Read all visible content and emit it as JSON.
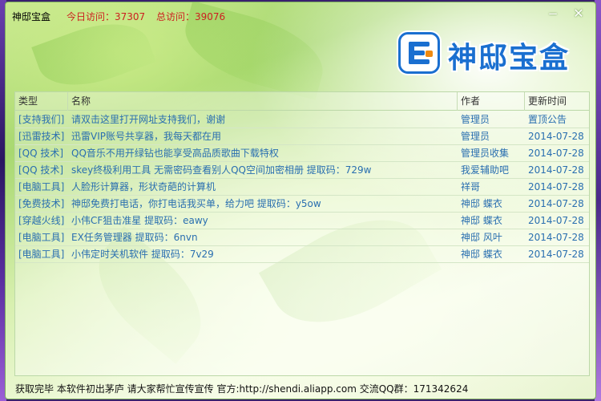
{
  "titlebar": {
    "app_title": "神邸宝盒",
    "today_visits": "今日访问：37307",
    "total_visits": "总访问：39076",
    "minimize_glyph": "−",
    "close_glyph": "✕"
  },
  "logo": {
    "text": "神邸宝盒",
    "icon": "e-logo-icon",
    "brand_color": "#1a6fd0",
    "accent_color": "#f08a10"
  },
  "table": {
    "columns": [
      "类型",
      "名称",
      "作者",
      "更新时间"
    ],
    "rows": [
      {
        "type": "[支持我们]",
        "name": "请双击这里打开网址支持我们，谢谢",
        "author": "管理员",
        "date": "置顶公告"
      },
      {
        "type": "[迅雷技术]",
        "name": "迅雷VIP账号共享器，我每天都在用",
        "author": "管理员",
        "date": "2014-07-28"
      },
      {
        "type": "[QQ 技术]",
        "name": "QQ音乐不用开绿钻也能享受高品质歌曲下载特权",
        "author": "管理员收集",
        "date": "2014-07-28"
      },
      {
        "type": "[QQ 技术]",
        "name": "skey终极利用工具 无需密码查看别人QQ空间加密相册    提取码：729w",
        "author": "我爱辅助吧",
        "date": "2014-07-28"
      },
      {
        "type": "[电脑工具]",
        "name": "人脸形计算器，形状奇葩的计算机",
        "author": "祥哥",
        "date": "2014-07-28"
      },
      {
        "type": "[免费技术]",
        "name": "神邸免费打电话，你打电话我买单，给力吧    提取码：y5ow",
        "author": "神邸 蝶衣",
        "date": "2014-07-28"
      },
      {
        "type": "[穿越火线]",
        "name": "小伟CF狙击准星     提取码：eawy",
        "author": "神邸 蝶衣",
        "date": "2014-07-28"
      },
      {
        "type": "[电脑工具]",
        "name": "EX任务管理器     提取码：6nvn",
        "author": "神邸 风叶",
        "date": "2014-07-28"
      },
      {
        "type": "[电脑工具]",
        "name": "小伟定时关机软件     提取码：7v29",
        "author": "神邸 蝶衣",
        "date": "2014-07-28"
      }
    ]
  },
  "statusbar": {
    "text": "获取完毕 本软件初出茅庐 请大家帮忙宣传宣传 官方:http://shendi.aliapp.com 交流QQ群：171342624"
  }
}
